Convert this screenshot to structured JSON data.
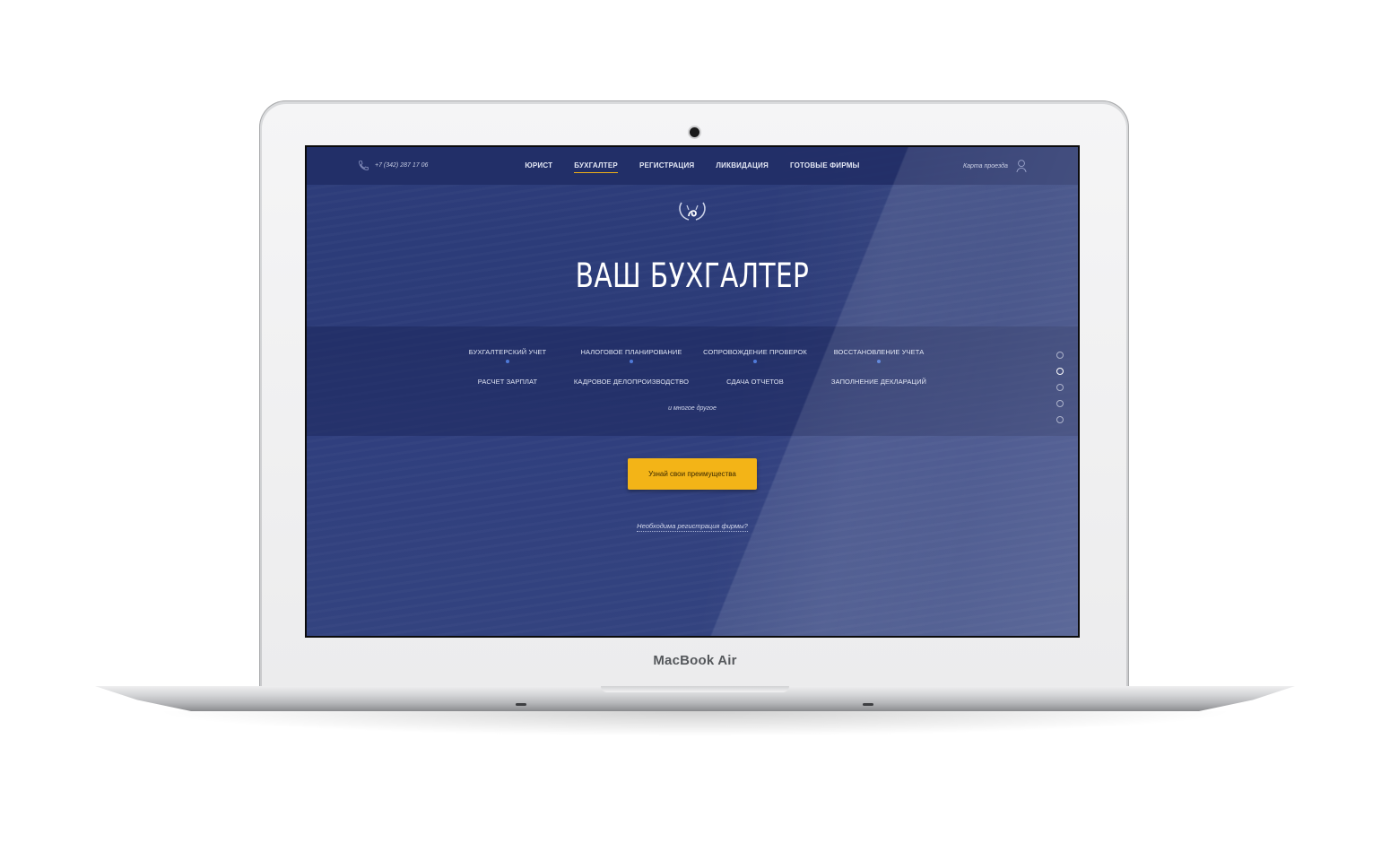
{
  "device": {
    "brand_label": "MacBook Air"
  },
  "header": {
    "phone": "+7 (342) 287 17 06",
    "nav": [
      {
        "label": "ЮРИСТ",
        "active": false
      },
      {
        "label": "БУХГАЛТЕР",
        "active": true
      },
      {
        "label": "РЕГИСТРАЦИЯ",
        "active": false
      },
      {
        "label": "ЛИКВИДАЦИЯ",
        "active": false
      },
      {
        "label": "ГОТОВЫЕ ФИРМЫ",
        "active": false
      }
    ],
    "map_link": "Карта проезда"
  },
  "hero": {
    "title": "ВАШ БУХГАЛТЕР",
    "services_row1": [
      "БУХГАЛТЕРСКИЙ УЧЕТ",
      "НАЛОГОВОЕ ПЛАНИРОВАНИЕ",
      "СОПРОВОЖДЕНИЕ ПРОВЕРОК",
      "ВОССТАНОВЛЕНИЕ УЧЕТА"
    ],
    "services_row2": [
      "РАСЧЕТ ЗАРПЛАТ",
      "КАДРОВОЕ ДЕЛОПРОИЗВОДСТВО",
      "СДАЧА ОТЧЕТОВ",
      "ЗАПОЛНЕНИЕ ДЕКЛАРАЦИЙ"
    ],
    "more": "и многое другое",
    "cta": "Узнай свои преимущества",
    "registration_link": "Необходима регистрация фирмы?"
  },
  "pager": {
    "count": 5,
    "active_index": 1
  },
  "colors": {
    "accent": "#f3b417",
    "background": "#2d3d7a",
    "dot": "#4f7ad8"
  }
}
